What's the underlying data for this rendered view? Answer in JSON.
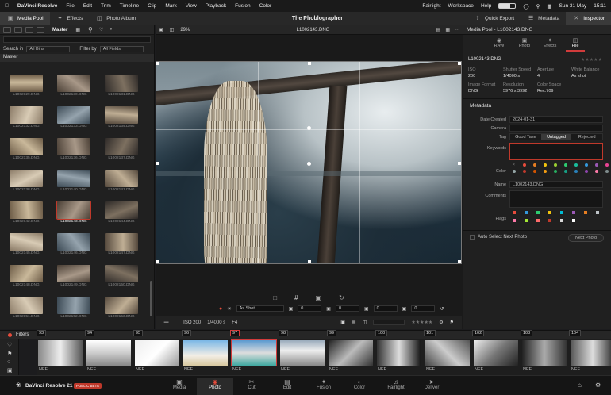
{
  "menubar": {
    "app": "DaVinci Resolve",
    "items": [
      "File",
      "Edit",
      "Trim",
      "Timeline",
      "Clip",
      "Mark",
      "View",
      "Playback",
      "Fusion",
      "Color"
    ],
    "right_items": [
      "Fairlight",
      "Workspace",
      "Help"
    ],
    "date": "Sun 31 May",
    "time": "15:11"
  },
  "toolbar": {
    "media_pool": "Media Pool",
    "effects": "Effects",
    "photo_album": "Photo Album",
    "title": "The Phoblographer",
    "quick_export": "Quick Export",
    "metadata": "Metadata",
    "inspector": "Inspector"
  },
  "left": {
    "bin": "Master",
    "search_in_label": "Search in",
    "search_in_value": "All Bins",
    "filter_label": "Filter by",
    "filter_value": "All Fields",
    "breadcrumb": "Master",
    "thumbs": [
      "L1002129.DNG",
      "L1002130.DNG",
      "L1002131.DNG",
      "L1002132.DNG",
      "L1002133.DNG",
      "L1002134.DNG",
      "L1002135.DNG",
      "L1002136.DNG",
      "L1002137.DNG",
      "L1002138.DNG",
      "L1002140.DNG",
      "L1002141.DNG",
      "L1002142.DNG",
      "L1002143.DNG",
      "L1002144.DNG",
      "L1002145.DNG",
      "L1002146.DNG",
      "L1002147.DNG",
      "L1002148.DNG",
      "L1002149.DNG",
      "L1002150.DNG",
      "L1002151.DNG",
      "L1002152.DNG",
      "L1002153.DNG"
    ]
  },
  "viewer": {
    "zoom": "29%",
    "filename": "L1002143.DNG",
    "shot": "As Shot",
    "iso": "ISO 200",
    "shutter": "1/4000 s",
    "fstop": "F4",
    "v1": "0",
    "v2": "0",
    "v3": "0",
    "v4": "0"
  },
  "inspector": {
    "header": "Media Pool - L1002143.DNG",
    "tabs": [
      "RAW",
      "Photo",
      "Effects",
      "File"
    ],
    "filename": "L1002143.DNG",
    "iso_k": "ISO",
    "iso_v": "200",
    "shutter_k": "Shutter Speed",
    "shutter_v": "1/4000 s",
    "aperture_k": "Aperture",
    "aperture_v": "4",
    "wb_k": "White Balance",
    "wb_v": "As shot",
    "fmt_k": "Image Format",
    "fmt_v": "DNG",
    "res_k": "Resolution",
    "res_v": "5976 x 3992",
    "cs_k": "Color Space",
    "cs_v": "Rec.709",
    "metadata_title": "Metadata",
    "date_created_k": "Date Created",
    "date_created_v": "2024-01-31",
    "camera_k": "Camera",
    "tag_k": "Tag",
    "tag_opts": [
      "Good Take",
      "Untagged",
      "Rejected"
    ],
    "keywords_k": "Keywords",
    "color_k": "Color",
    "name_k": "Name",
    "name_v": "L1002143.DNG",
    "comments_k": "Comments",
    "flags_k": "Flags",
    "auto_select": "Auto Select Next Photo",
    "next_photo": "Next Photo"
  },
  "film": {
    "filters": "Filters",
    "nums": [
      "93",
      "94",
      "95",
      "96",
      "97",
      "98",
      "99",
      "100",
      "101",
      "102",
      "103",
      "104"
    ],
    "ext": "NEF"
  },
  "bottom": {
    "brand": "DaVinci Resolve 21",
    "beta": "PUBLIC BETA",
    "pages": [
      "Media",
      "Photo",
      "Cut",
      "Edit",
      "Fusion",
      "Color",
      "Fairlight",
      "Deliver"
    ]
  }
}
